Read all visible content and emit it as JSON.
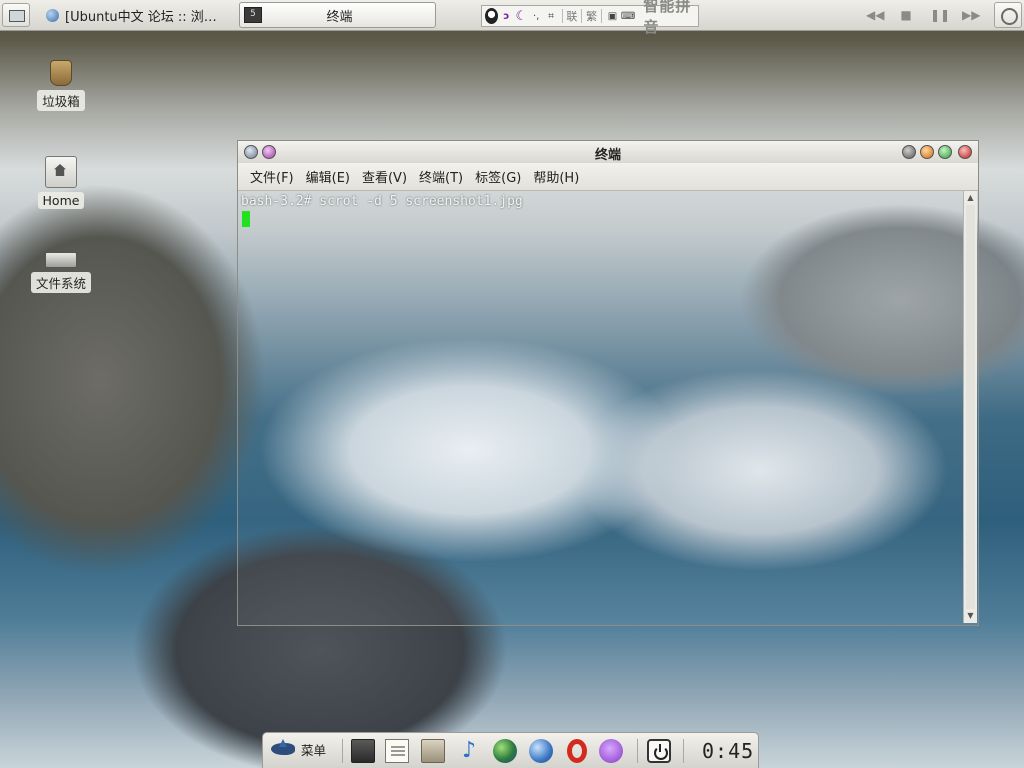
{
  "top_panel": {
    "tasks": [
      {
        "label": "[Ubuntu中文 论坛 :: 浏…",
        "active": false
      },
      {
        "label": "终端",
        "active": true
      }
    ],
    "ime": {
      "items": [
        "联",
        "繁"
      ],
      "name": "智能拼音"
    },
    "media_controls": [
      "◀◀",
      "■",
      "❚❚",
      "▶▶"
    ]
  },
  "desktop_icons": [
    {
      "label": "垃圾箱",
      "icon": "trash-icon"
    },
    {
      "label": "Home",
      "icon": "home-folder-icon"
    },
    {
      "label": "文件系统",
      "icon": "filesystem-icon"
    }
  ],
  "terminal": {
    "title": "终端",
    "menu": [
      "文件(F)",
      "编辑(E)",
      "查看(V)",
      "终端(T)",
      "标签(G)",
      "帮助(H)"
    ],
    "prompt": "bash-3.2# scrot -d 5 screenshot1.jpg",
    "scroll_up": "▲",
    "scroll_down": "▼"
  },
  "dock": {
    "menu_label": "菜单",
    "launchers": [
      "terminal-icon",
      "text-editor-icon",
      "file-manager-icon",
      "music-player-icon",
      "earth-icon",
      "web-browser-icon",
      "opera-browser-icon",
      "chat-icon",
      "power-icon"
    ],
    "clock": "0:45"
  },
  "colors": {
    "cursor": "#22e11f",
    "panel": "#e4e3dd",
    "terminal_text": "#f3f3f3"
  }
}
